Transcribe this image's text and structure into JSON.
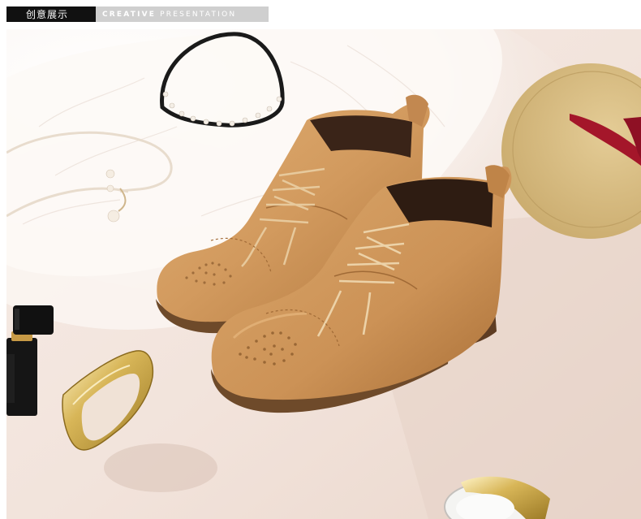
{
  "header": {
    "title_cn": "创意展示",
    "title_en_bold": "CREATIVE",
    "title_en_light": "PRESENTATION"
  },
  "colors": {
    "header_dark": "#111111",
    "header_gray": "#cfcfcf",
    "boot_leather": "#d29a5e",
    "boot_shadow": "#b47a40",
    "sole": "#6e4a2a",
    "backdrop": "#f3e6de"
  }
}
